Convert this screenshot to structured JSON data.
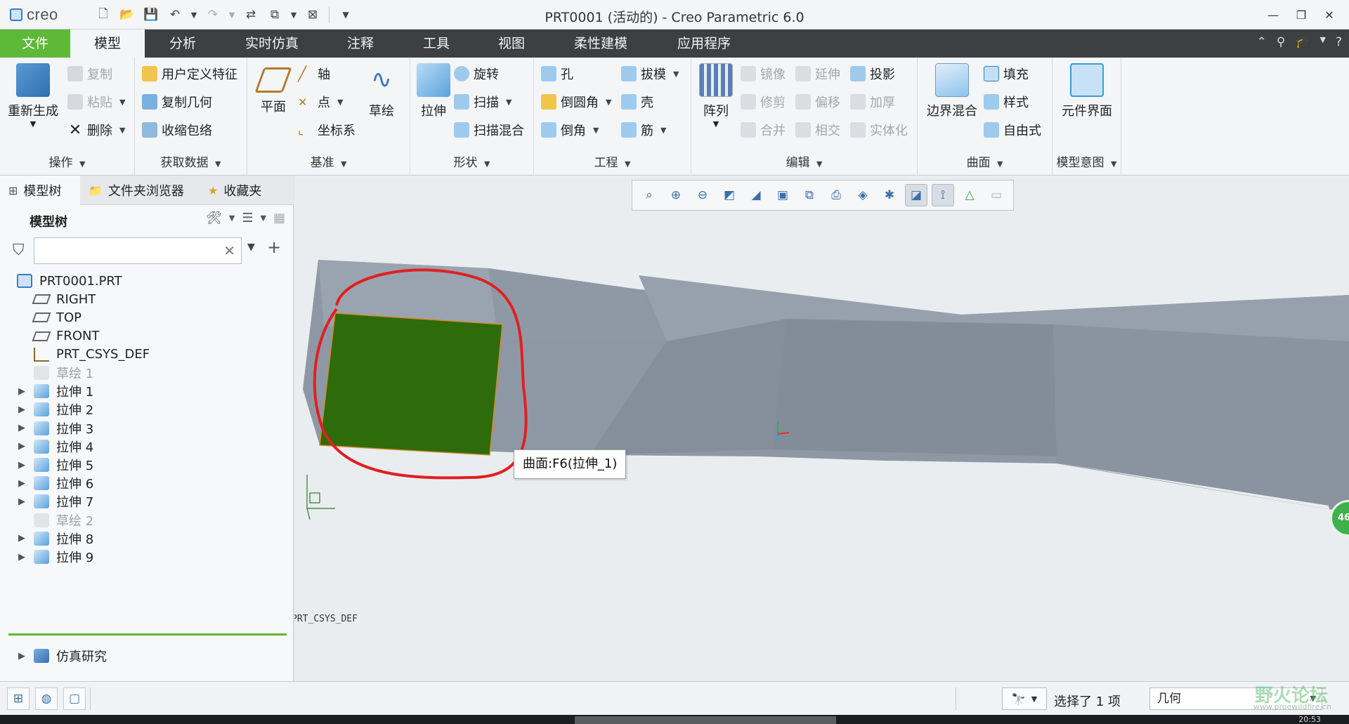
{
  "app": {
    "logo_text": "creo",
    "window_title": "PRT0001 (活动的) - Creo Parametric 6.0"
  },
  "tabs": [
    "文件",
    "模型",
    "分析",
    "实时仿真",
    "注释",
    "工具",
    "视图",
    "柔性建模",
    "应用程序"
  ],
  "ribbon": {
    "operations": {
      "label": "操作",
      "regenerate": "重新生成",
      "copy": "复制",
      "paste": "粘贴",
      "delete": "删除"
    },
    "get_data": {
      "label": "获取数据",
      "udf": "用户定义特征",
      "copy_geom": "复制几何",
      "shrinkwrap": "收缩包络"
    },
    "datum": {
      "label": "基准",
      "plane": "平面",
      "axis": "轴",
      "point": "点",
      "csys": "坐标系",
      "sketch": "草绘"
    },
    "shapes": {
      "label": "形状",
      "extrude": "拉伸",
      "revolve": "旋转",
      "sweep": "扫描",
      "swept_blend": "扫描混合"
    },
    "engineering": {
      "label": "工程",
      "hole": "孔",
      "round": "倒圆角",
      "chamfer": "倒角",
      "draft": "拔模",
      "shell": "壳",
      "rib": "筋"
    },
    "editing": {
      "label": "编辑",
      "pattern": "阵列",
      "mirror": "镜像",
      "extend": "延伸",
      "project": "投影",
      "trim": "修剪",
      "offset": "偏移",
      "thicken": "加厚",
      "merge": "合并",
      "intersect": "相交",
      "solidify": "实体化"
    },
    "surfaces": {
      "label": "曲面",
      "boundary_blend": "边界混合",
      "fill": "填充",
      "style": "样式",
      "freestyle": "自由式"
    },
    "model_intent": {
      "label": "模型意图",
      "component_interface": "元件界面"
    }
  },
  "panel": {
    "tabs": [
      "模型树",
      "文件夹浏览器",
      "收藏夹"
    ],
    "tree_title": "模型树",
    "search_placeholder": "",
    "nodes": [
      {
        "label": "PRT0001.PRT",
        "kind": "part",
        "dim": false
      },
      {
        "label": "RIGHT",
        "kind": "plane",
        "dim": false
      },
      {
        "label": "TOP",
        "kind": "plane",
        "dim": false
      },
      {
        "label": "FRONT",
        "kind": "plane",
        "dim": false
      },
      {
        "label": "PRT_CSYS_DEF",
        "kind": "csys",
        "dim": false
      },
      {
        "label": "草绘 1",
        "kind": "sketch",
        "dim": true
      },
      {
        "label": "拉伸 1",
        "kind": "extrude",
        "dim": false
      },
      {
        "label": "拉伸 2",
        "kind": "extrude",
        "dim": false
      },
      {
        "label": "拉伸 3",
        "kind": "extrude",
        "dim": false
      },
      {
        "label": "拉伸 4",
        "kind": "extrude",
        "dim": false
      },
      {
        "label": "拉伸 5",
        "kind": "extrude",
        "dim": false
      },
      {
        "label": "拉伸 6",
        "kind": "extrude",
        "dim": false
      },
      {
        "label": "拉伸 7",
        "kind": "extrude",
        "dim": false
      },
      {
        "label": "草绘 2",
        "kind": "sketch",
        "dim": true
      },
      {
        "label": "拉伸 8",
        "kind": "extrude",
        "dim": false
      },
      {
        "label": "拉伸 9",
        "kind": "extrude",
        "dim": false
      }
    ],
    "sim_study": "仿真研究"
  },
  "viewport": {
    "tooltip": "曲面:F6(拉伸_1)",
    "csys_label": "PRT_CSYS_DEF",
    "badge": "46",
    "colors": {
      "selected_surface": "#2e6b0a",
      "annotation": "#e02020",
      "body": "#8f99a6"
    }
  },
  "status": {
    "selection": "选择了 1 项",
    "filter_value": "几何",
    "clock": "20:53"
  },
  "watermark": {
    "text": "野火论坛",
    "sub": "www.proewildfire.cn"
  }
}
